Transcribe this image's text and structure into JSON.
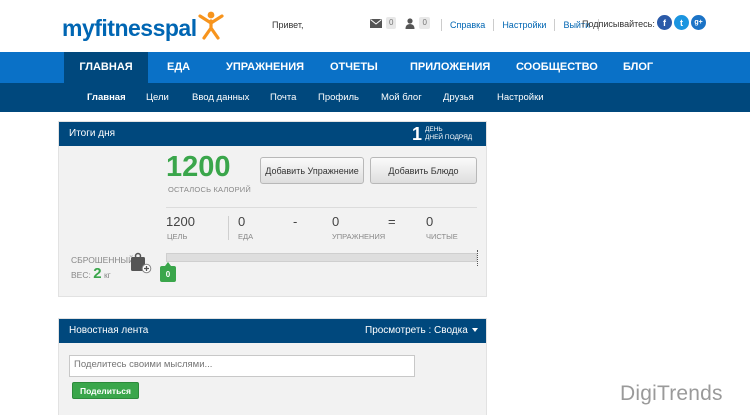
{
  "header": {
    "logo": {
      "part1": "my",
      "part2": "fitnesspal"
    },
    "greeting": "Привет,",
    "messages_count": "0",
    "friends_count": "0",
    "links": [
      "Справка",
      "Настройки",
      "Выйти"
    ],
    "subscribe_label": "Подписывайтесь:",
    "social": {
      "facebook": "f",
      "twitter": "t",
      "google": "g+"
    }
  },
  "main_nav": [
    "ГЛАВНАЯ",
    "ЕДА",
    "УПРАЖНЕНИЯ",
    "ОТЧЕТЫ",
    "ПРИЛОЖЕНИЯ",
    "СООБЩЕСТВО",
    "БЛОГ"
  ],
  "sub_nav": [
    "Главная",
    "Цели",
    "Ввод данных",
    "Почта",
    "Профиль",
    "Мой блог",
    "Друзья",
    "Настройки"
  ],
  "summary": {
    "title": "Итоги дня",
    "streak_number": "1",
    "streak_line1": "ДЕНЬ",
    "streak_line2": "ДНЕЙ ПОДРЯД",
    "calories_left": "1200",
    "calories_left_label": "ОСТАЛОСЬ КАЛОРИЙ",
    "add_exercise": "Добавить Упражнение",
    "add_food": "Добавить Блюдо",
    "equation": {
      "goal": {
        "value": "1200",
        "label": "ЦЕЛЬ"
      },
      "food": {
        "value": "0",
        "label": "ЕДА"
      },
      "minus": "-",
      "exercise": {
        "value": "0",
        "label": "УПРАЖНЕНИЯ"
      },
      "equals": "=",
      "net": {
        "value": "0",
        "label": "ЧИСТЫЕ"
      }
    },
    "weight_lost_label": "СБРОШЕННЫЙ",
    "weight_prefix": "ВЕС:",
    "weight_value": "2",
    "weight_unit": "кг",
    "progress_fraction": 0,
    "progress_badge": "0"
  },
  "feed": {
    "title": "Новостная лента",
    "view_label": "Просмотреть : Сводка",
    "placeholder": "Поделитесь своими мыслями...",
    "share_button": "Поделиться"
  },
  "watermark": "DigiTrends",
  "colors": {
    "brand_blue": "#0a71c7",
    "dark_blue": "#00487d",
    "accent_green": "#3aa64b",
    "logo_orange": "#f7941d"
  }
}
